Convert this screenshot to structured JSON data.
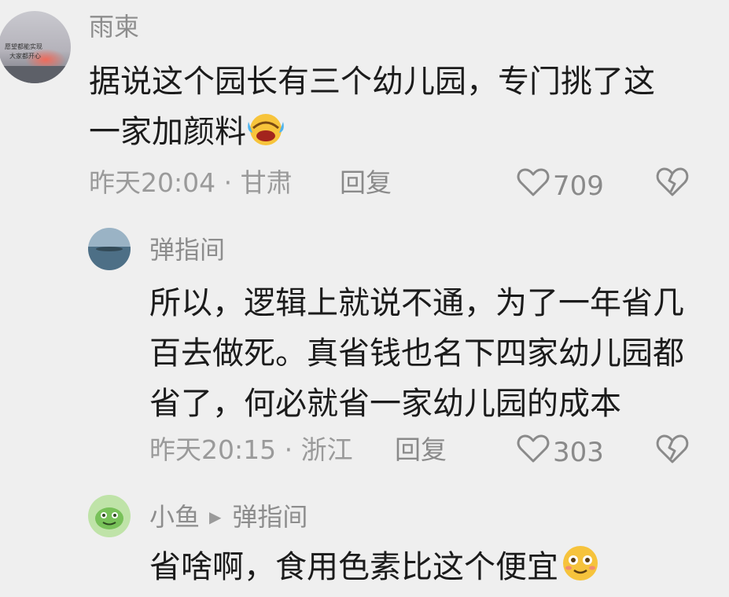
{
  "comments": [
    {
      "username": "雨柬",
      "lines": [
        "据说这个园长有三个幼儿园，专门挑了这",
        "一家加颜料"
      ],
      "emoji": "laughing-crying-emoji",
      "meta": "昨天20:04 · 甘肃",
      "reply_label": "回复",
      "likes": "709"
    },
    {
      "username": "弹指间",
      "lines": [
        "所以，逻辑上就说不通，为了一年省几",
        "百去做死。真省钱也名下四家幼儿园都",
        "省了，何必就省一家幼儿园的成本"
      ],
      "meta": "昨天20:15 · 浙江",
      "reply_label": "回复",
      "likes": "303"
    },
    {
      "username": "小鱼",
      "reply_to": "弹指间",
      "lines": [
        "省啥啊，食用色素比这个便宜"
      ],
      "emoji": "smiling-emoji"
    }
  ],
  "icons": {
    "like": "heart-outline-icon",
    "dislike": "broken-heart-icon",
    "reply_arrow": "play-triangle-icon"
  },
  "colors": {
    "background": "#efefef",
    "text": "#1b1b1b",
    "muted": "#9a9a9a"
  }
}
